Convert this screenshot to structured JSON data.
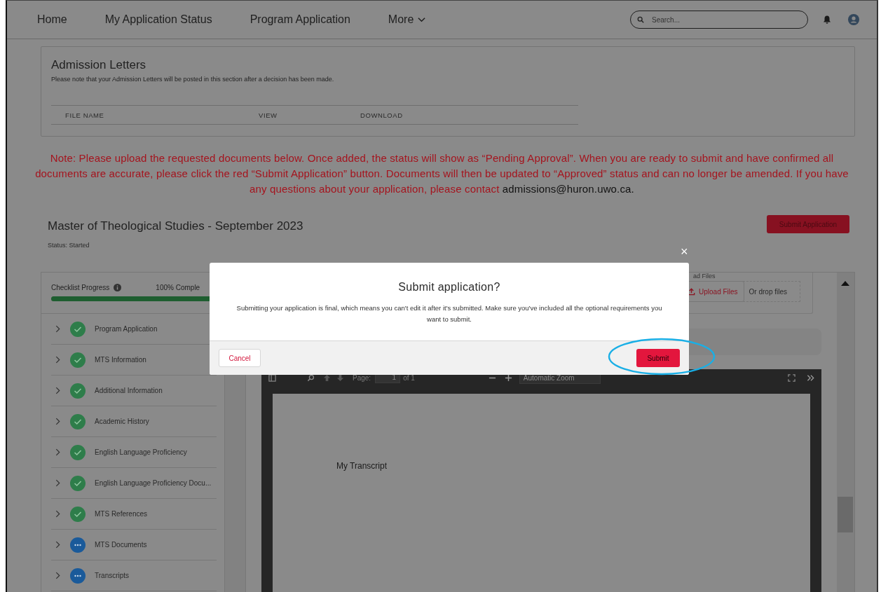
{
  "nav": {
    "items": [
      {
        "label": "Home",
        "has_menu": false
      },
      {
        "label": "My Application Status",
        "has_menu": false
      },
      {
        "label": "Program Application",
        "has_menu": false
      },
      {
        "label": "More",
        "has_menu": true
      }
    ],
    "search": {
      "placeholder": "Search..."
    }
  },
  "admission_letters": {
    "title": "Admission Letters",
    "note": "Please note that your Admission Letters will be posted in this section after a decision has been made.",
    "columns": [
      "FILE NAME",
      "VIEW",
      "DOWNLOAD"
    ]
  },
  "notice": {
    "text": "Note: Please upload the requested documents below. Once added, the status will show as “Pending Approval”. When you are ready to submit and have confirmed all documents are accurate, please click the red “Submit Application” button. Documents will then be updated to “Approved” status and can no longer be amended. If you have any questions about your application, please contact",
    "link": "admissions@huron.uwo.ca."
  },
  "program": {
    "title": "Master of Theological Studies - September 2023",
    "status": "Status: Started",
    "submit_button": "Submit Application"
  },
  "checklist": {
    "title": "Checklist Progress",
    "progress_label": "100% Comple",
    "level": 1,
    "items": [
      {
        "label": "Program Application",
        "complete": true
      },
      {
        "label": "MTS Information",
        "complete": true
      },
      {
        "label": "Additional Information",
        "complete": true
      },
      {
        "label": "Academic History",
        "complete": true
      },
      {
        "label": "English Language Proficiency",
        "complete": true
      },
      {
        "label": "English Language Proficiency Docu...",
        "complete": true
      },
      {
        "label": "MTS References",
        "complete": true
      },
      {
        "label": "MTS Documents",
        "complete": false
      },
      {
        "label": "Transcripts",
        "complete": false
      }
    ]
  },
  "upload": {
    "label": "ad Files",
    "button": "Upload Files",
    "drop_hint": "Or drop files"
  },
  "pdf_viewer": {
    "page_label": "Page:",
    "page": "1",
    "page_count": "of 1",
    "zoom": "Automatic Zoom",
    "document_text": "My Transcript"
  },
  "dialog": {
    "close": "×",
    "title": "Submit application?",
    "message": "Submitting your application is final, which means you can't edit it after it's submitted. Make sure you've included all the optional requirements you want to submit.",
    "cancel": "Cancel",
    "submit": "Submit"
  }
}
